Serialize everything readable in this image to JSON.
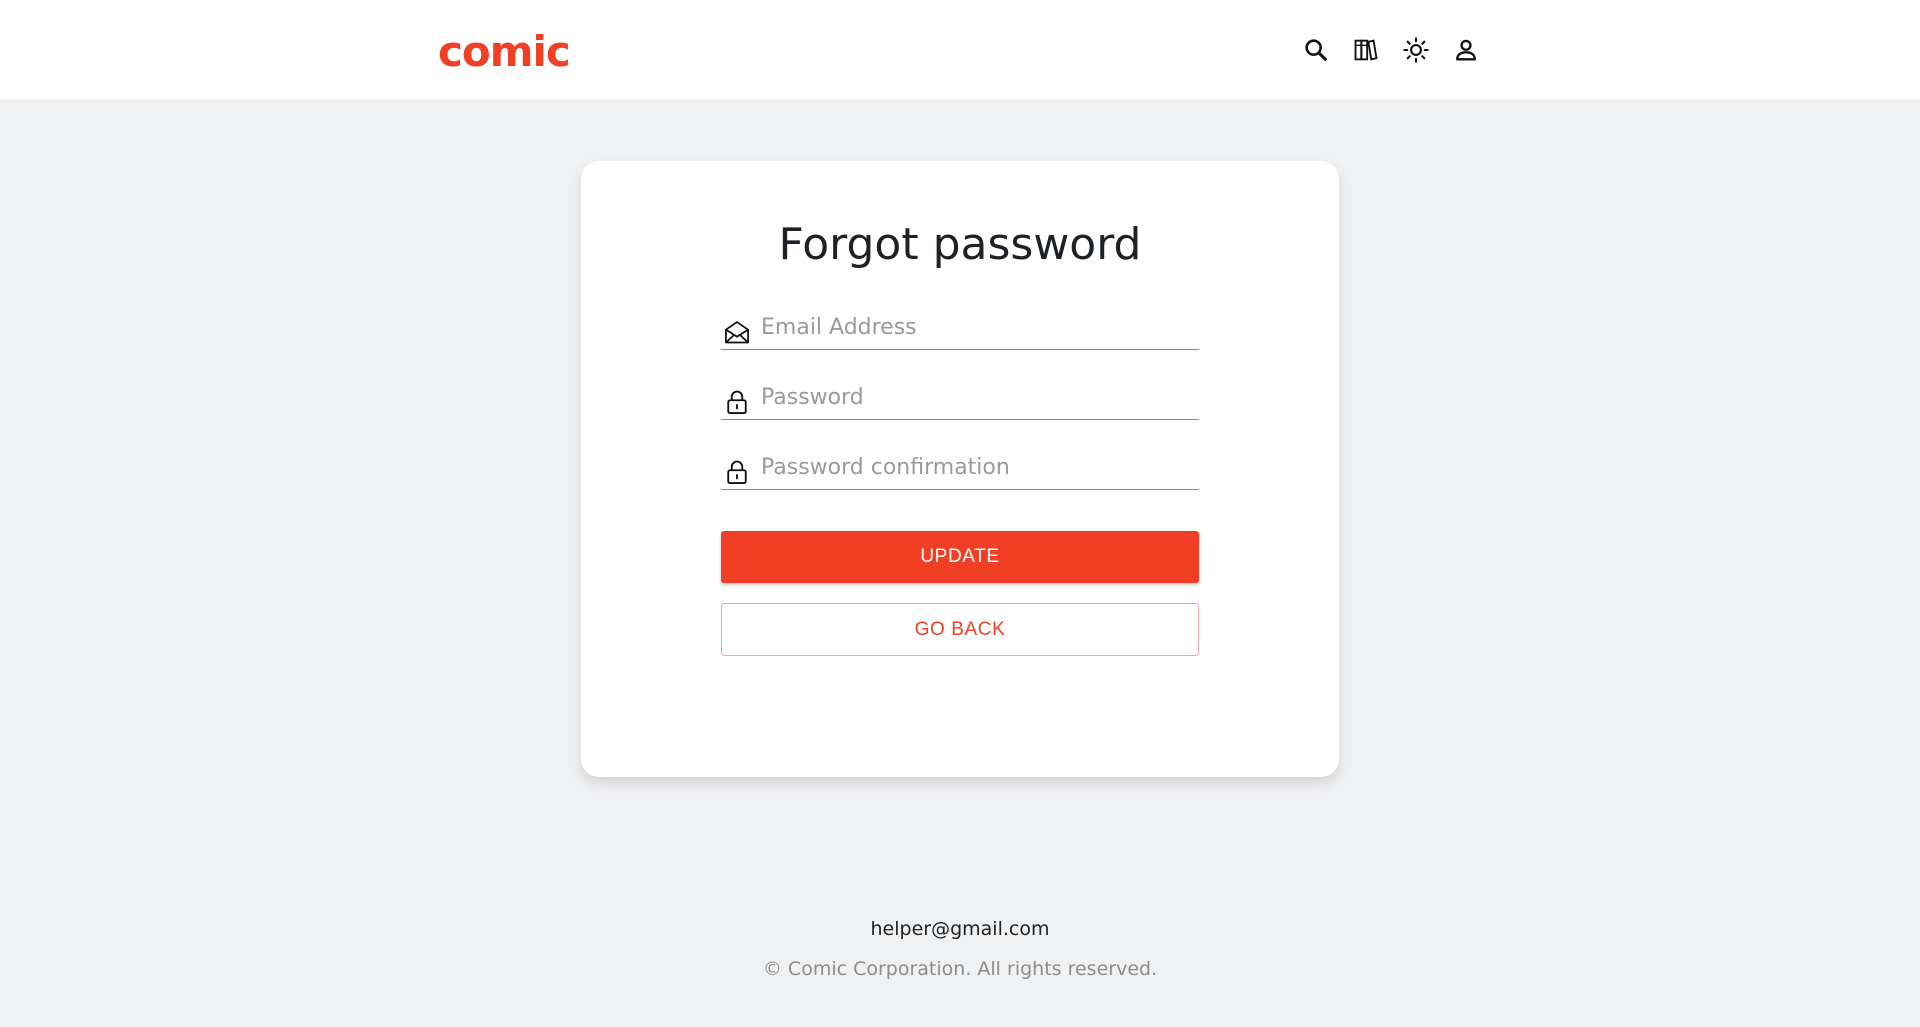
{
  "header": {
    "logo_text": "comic",
    "icons": [
      "search-icon",
      "books-icon",
      "sun-icon",
      "user-icon"
    ]
  },
  "form": {
    "title": "Forgot password",
    "email_placeholder": "Email Address",
    "password_placeholder": "Password",
    "password_confirm_placeholder": "Password confirmation",
    "update_label": "UPDATE",
    "back_label": "GO BACK"
  },
  "footer": {
    "email": "helper@gmail.com",
    "copyright": "© Comic Corporation. All rights reserved."
  },
  "colors": {
    "brand": "#f03f24",
    "background": "#f0f1f3"
  }
}
